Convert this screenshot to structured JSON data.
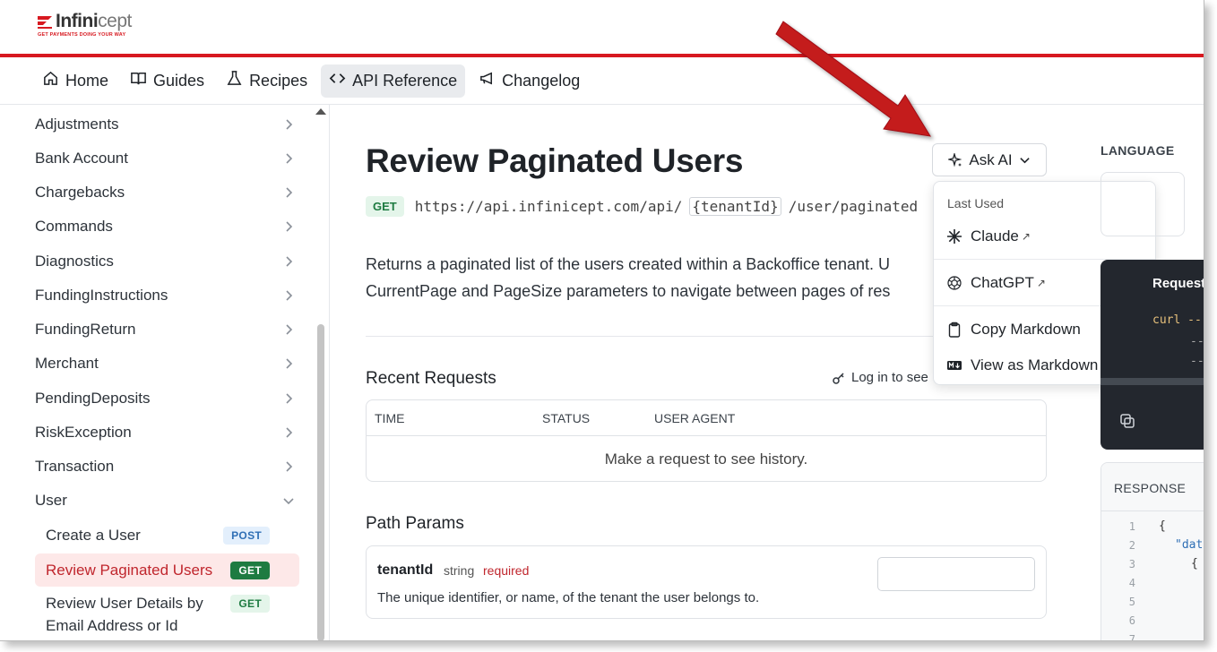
{
  "brand": {
    "name_part1": "Infini",
    "name_part2": "cept",
    "tagline": "GET PAYMENTS DOING YOUR WAY",
    "accent_color": "#d71920"
  },
  "nav": {
    "tabs": [
      {
        "label": "Home",
        "icon": "home-icon"
      },
      {
        "label": "Guides",
        "icon": "book-icon"
      },
      {
        "label": "Recipes",
        "icon": "flask-icon"
      },
      {
        "label": "API Reference",
        "icon": "code-icon",
        "active": true
      },
      {
        "label": "Changelog",
        "icon": "megaphone-icon"
      }
    ]
  },
  "sidebar": {
    "items": [
      {
        "label": "Adjustments"
      },
      {
        "label": "Bank Account"
      },
      {
        "label": "Chargebacks"
      },
      {
        "label": "Commands"
      },
      {
        "label": "Diagnostics"
      },
      {
        "label": "FundingInstructions"
      },
      {
        "label": "FundingReturn"
      },
      {
        "label": "Merchant"
      },
      {
        "label": "PendingDeposits"
      },
      {
        "label": "RiskException"
      },
      {
        "label": "Transaction"
      },
      {
        "label": "User"
      }
    ],
    "sub_items": [
      {
        "label": "Create a User",
        "method": "POST"
      },
      {
        "label": "Review Paginated Users",
        "method": "GET",
        "active": true
      },
      {
        "label_line1": "Review User Details by",
        "label_line2": "Email Address or Id",
        "method": "GET"
      }
    ]
  },
  "main": {
    "title": "Review Paginated Users",
    "method": "GET",
    "url_prefix": "https://api.infinicept.com/api/",
    "url_param": "{tenantId}",
    "url_suffix": "/user/paginated",
    "description_line1": "Returns a paginated list of the users created within a Backoffice tenant. U",
    "description_line2": "CurrentPage and PageSize parameters to navigate between pages of res",
    "recent_requests": {
      "title": "Recent Requests",
      "login_text": "Log in to see",
      "columns": [
        "TIME",
        "STATUS",
        "USER AGENT"
      ],
      "empty_text": "Make a request to see history."
    },
    "path_params": {
      "title": "Path Params",
      "name": "tenantId",
      "type": "string",
      "required": "required",
      "description": "The unique identifier, or name, of the tenant the user belongs to."
    }
  },
  "ask_ai": {
    "label": "Ask AI",
    "menu": {
      "section_label": "Last Used",
      "items": [
        {
          "label": "Claude",
          "icon": "claude-icon",
          "external": "↗"
        },
        {
          "label": "ChatGPT",
          "icon": "chatgpt-icon",
          "external": "↗"
        },
        {
          "label": "Copy Markdown",
          "icon": "clipboard-icon"
        },
        {
          "label": "View as Markdown",
          "icon": "markdown-icon"
        }
      ]
    }
  },
  "right_panel": {
    "language_label": "LANGUAGE",
    "code_title": "Request",
    "code_lines": [
      "curl --",
      "--",
      "--"
    ],
    "response_label": "RESPONSE",
    "response_lines": [
      {
        "n": "1",
        "text": "{"
      },
      {
        "n": "2",
        "text": "\"dat"
      },
      {
        "n": "3",
        "text": "{"
      },
      {
        "n": "4",
        "text": ""
      },
      {
        "n": "5",
        "text": ""
      },
      {
        "n": "6",
        "text": ""
      },
      {
        "n": "7",
        "text": ""
      }
    ]
  }
}
